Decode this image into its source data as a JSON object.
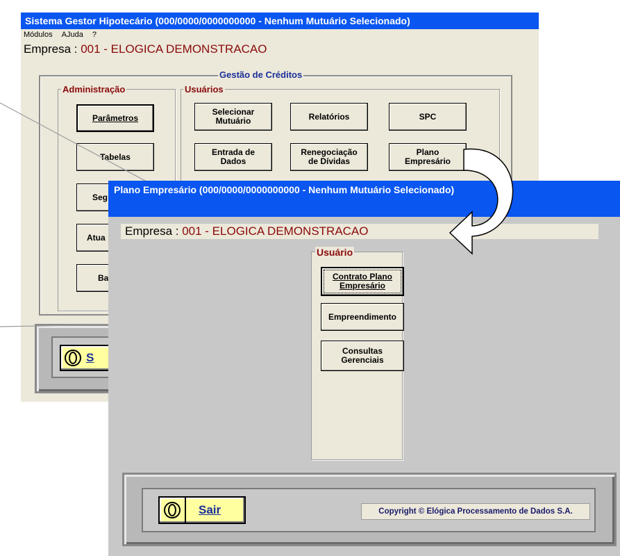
{
  "back_window": {
    "title": "Sistema Gestor Hipotecário (000/0000/0000000000 - Nenhum Mutuário Selecionado)",
    "menu": [
      "Módulos",
      "AJuda",
      "?"
    ],
    "empresa_label": "Empresa : ",
    "empresa_value": "001 - ELOGICA DEMONSTRACAO",
    "group_title": "Gestão de Créditos",
    "admin": {
      "title": "Administração",
      "buttons": [
        "Parâmetros",
        "Tabelas",
        "Seg",
        "Atua",
        "Ba"
      ]
    },
    "usuarios": {
      "title": "Usuários",
      "buttons": [
        "Selecionar\nMutuário",
        "Relatórios",
        "SPC",
        "Entrada de\nDados",
        "Renegociação\nde Dívidas",
        "Plano\nEmpresário"
      ]
    },
    "footer_sair_partial": "S"
  },
  "front_window": {
    "title": "Plano Empresário (000/0000/0000000000 - Nenhum Mutuário Selecionado)",
    "empresa_label": "Empresa : ",
    "empresa_value": "001 - ELOGICA DEMONSTRACAO",
    "usuario_title": "Usuário",
    "buttons": [
      "Contrato Plano\nEmpresário",
      "Empreendimento",
      "Consultas\nGerenciais"
    ],
    "sair_label": "Sair",
    "copyright": "Copyright © Elógica Processamento de Dados S.A."
  },
  "colors": {
    "title_bar": "#0a56f0",
    "window_bg": "#ece8da",
    "empresa_value": "#8a0a0a",
    "group_title": "#1a2f9a",
    "sair_button": "#ffffa0"
  },
  "icons": [
    "logo-icon",
    "curved-arrow-icon"
  ]
}
